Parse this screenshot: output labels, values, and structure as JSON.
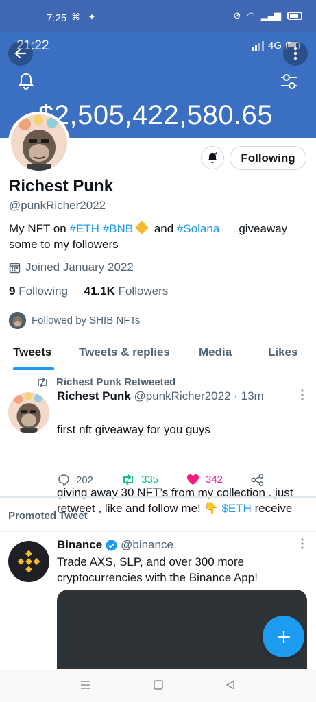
{
  "android_status": {
    "time": "7:25"
  },
  "ios_status": {
    "time": "21:22",
    "network": "4G"
  },
  "header": {
    "amount": "$2,505,422,580.65"
  },
  "profile": {
    "name": "Richest Punk",
    "handle": "@punkRicher2022",
    "bio": {
      "prefix": "My NFT on ",
      "tag_eth": "#ETH",
      "tag_bnb": "#BNB",
      "mid": " and ",
      "tag_solana": "#Solana",
      "suffix": "giveaway some to my followers"
    },
    "joined": "Joined January 2022",
    "following_count": "9",
    "following_label": "Following",
    "followers_count": "41.1K",
    "followers_label": "Followers",
    "followed_by": "Followed by SHIB NFTs",
    "following_button": "Following"
  },
  "tabs": [
    "Tweets",
    "Tweets & replies",
    "Media",
    "Likes"
  ],
  "tweet": {
    "retweeted_by": "Richest Punk Retweeted",
    "author_name": "Richest Punk",
    "author_handle": "@punkRicher2022",
    "time": "· 13m",
    "line1": "first nft giveaway for you guys",
    "line2": "giving away 30 NFT’s from my collection , just retweet , like and follow me! 👇 ",
    "tag": "$ETH",
    "line2_end": " receive",
    "replies": "202",
    "retweets": "335",
    "likes": "342"
  },
  "promoted": {
    "label": "Promoted Tweet",
    "author_name": "Binance",
    "author_handle": "@binance",
    "text": "Trade AXS, SLP, and over 300 more cryptocurrencies with the Binance App!"
  },
  "colors": {
    "twitter_blue": "#1d9bf0",
    "banner": "#3b6fc1",
    "like_pink": "#f91880",
    "retweet_green": "#00ba7c"
  }
}
